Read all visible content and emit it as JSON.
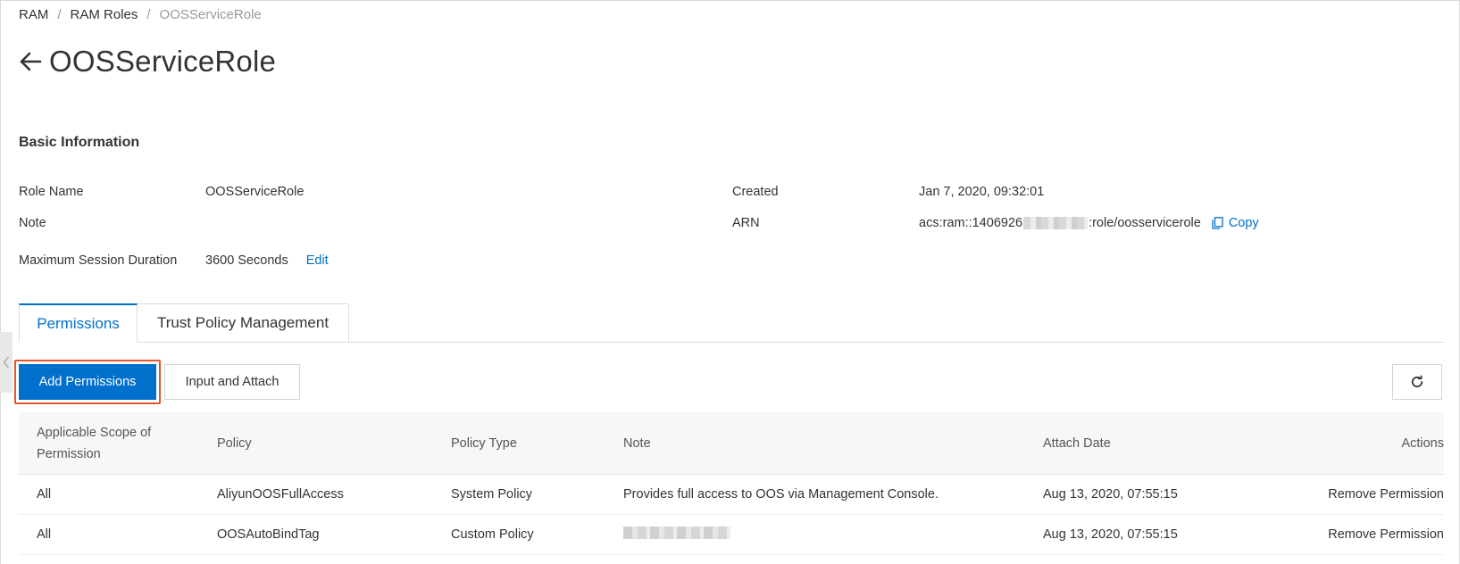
{
  "breadcrumb": {
    "items": [
      "RAM",
      "RAM Roles"
    ],
    "current": "OOSServiceRole"
  },
  "page": {
    "title": "OOSServiceRole"
  },
  "basic_info": {
    "title": "Basic Information",
    "role_name_label": "Role Name",
    "role_name_value": "OOSServiceRole",
    "note_label": "Note",
    "note_value": "",
    "session_label": "Maximum Session Duration",
    "session_value": "3600 Seconds",
    "edit_label": "Edit",
    "created_label": "Created",
    "created_value": "Jan 7, 2020, 09:32:01",
    "arn_label": "ARN",
    "arn_prefix": "acs:ram::1406926",
    "arn_suffix": ":role/oosservicerole",
    "copy_label": "Copy"
  },
  "tabs": [
    {
      "label": "Permissions",
      "active": true
    },
    {
      "label": "Trust Policy Management",
      "active": false
    }
  ],
  "toolbar": {
    "add_permissions_label": "Add Permissions",
    "input_attach_label": "Input and Attach"
  },
  "table": {
    "headers": {
      "scope": "Applicable Scope of Permission",
      "policy": "Policy",
      "policy_type": "Policy Type",
      "note": "Note",
      "attach_date": "Attach Date",
      "actions": "Actions"
    },
    "rows": [
      {
        "scope": "All",
        "policy": "AliyunOOSFullAccess",
        "policy_type": "System Policy",
        "note": "Provides full access to OOS via Management Console.",
        "attach_date": "Aug 13, 2020, 07:55:15",
        "action": "Remove Permission"
      },
      {
        "scope": "All",
        "policy": "OOSAutoBindTag",
        "policy_type": "Custom Policy",
        "note": "",
        "attach_date": "Aug 13, 2020, 07:55:15",
        "action": "Remove Permission"
      }
    ]
  },
  "colors": {
    "accent": "#0070cc",
    "highlight": "#e8522c"
  }
}
